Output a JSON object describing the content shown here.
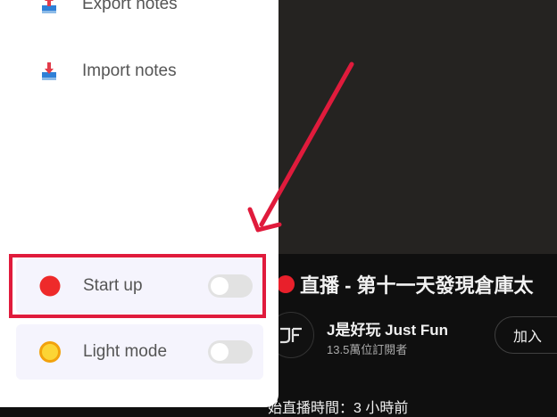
{
  "menu": {
    "items": [
      {
        "label": "Export notes",
        "icon": "export-icon"
      },
      {
        "label": "Import notes",
        "icon": "import-icon"
      }
    ]
  },
  "settings": {
    "start_up": {
      "label": "Start up",
      "icon": "red-circle-icon",
      "enabled": false
    },
    "light_mode": {
      "label": "Light mode",
      "icon": "sun-icon",
      "enabled": false
    }
  },
  "video": {
    "title": "直播 - 第十一天發現倉庫太",
    "channel_name": "J是好玩 Just Fun",
    "subscribers": "13.5萬位訂閱者",
    "join_label": "加入",
    "meta": "始直播時間：3 小時前"
  },
  "colors": {
    "highlight": "#e01b3c",
    "live_red": "#e8202b",
    "toggle_off": "#e2e2e2",
    "row_bg": "#f5f4fd"
  }
}
